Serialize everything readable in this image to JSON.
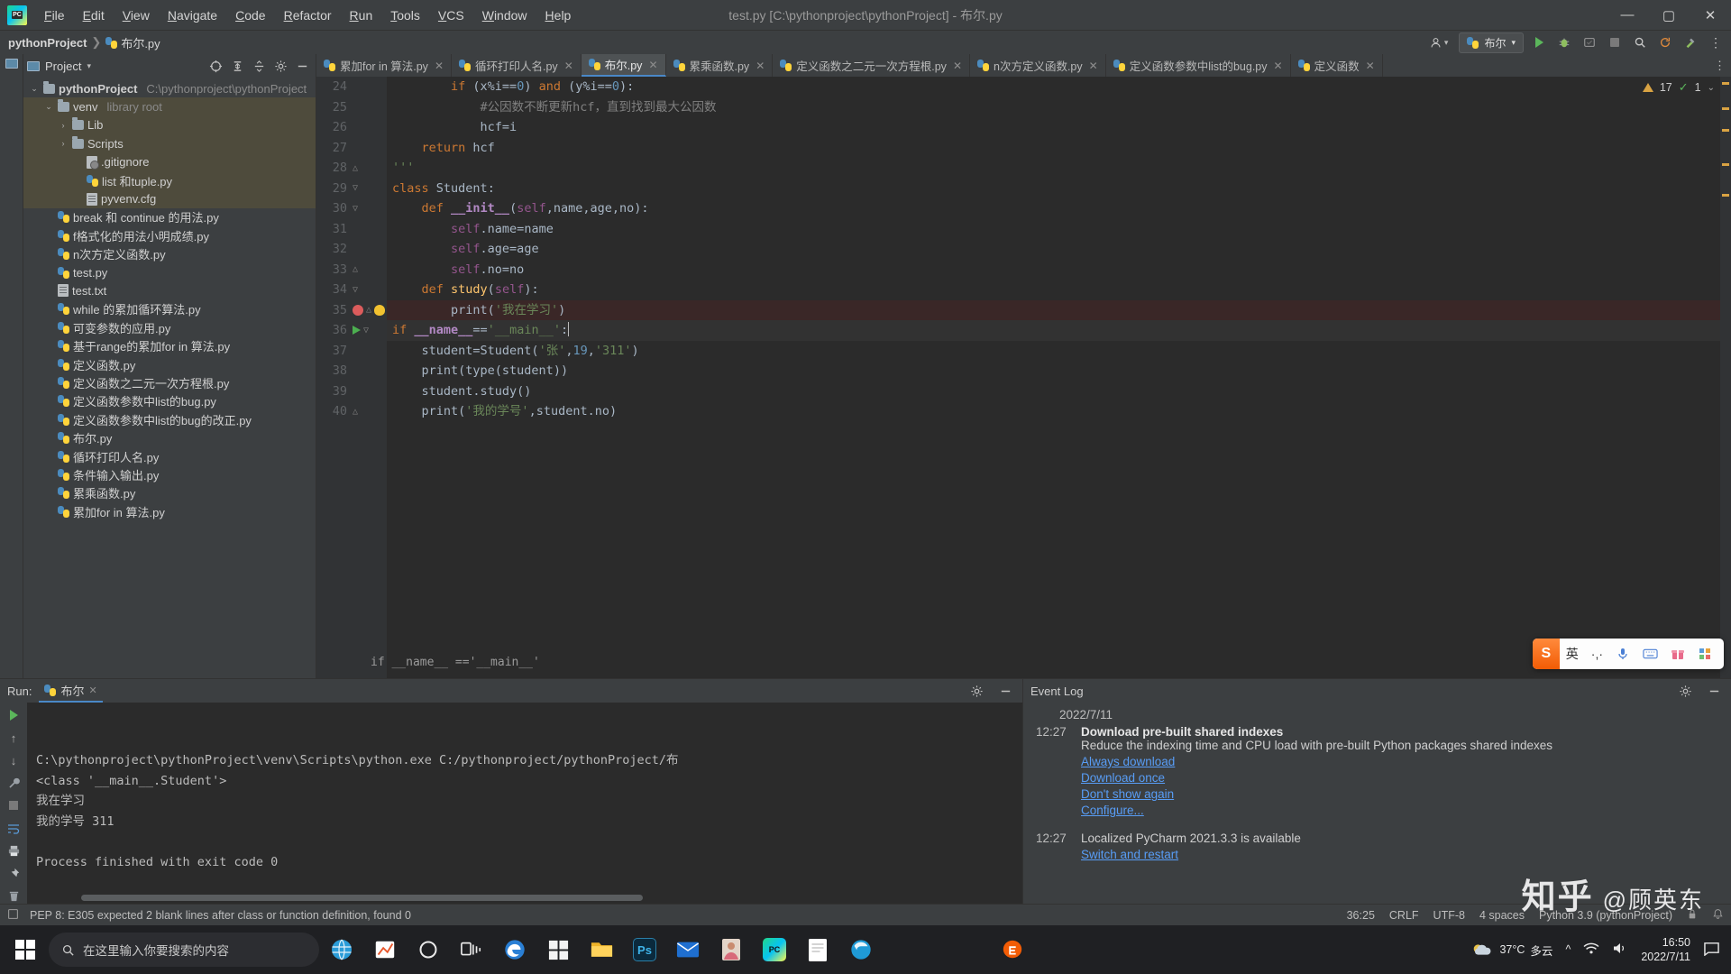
{
  "window": {
    "title": "test.py [C:\\pythonproject\\pythonProject] - 布尔.py",
    "minimize": "—",
    "maximize": "▢",
    "close": "✕",
    "logo_text": "PC"
  },
  "menu": {
    "items": [
      "File",
      "Edit",
      "View",
      "Navigate",
      "Code",
      "Refactor",
      "Run",
      "Tools",
      "VCS",
      "Window",
      "Help"
    ]
  },
  "breadcrumb": {
    "project": "pythonProject",
    "separator": "❯",
    "file": "布尔.py"
  },
  "navbar_right": {
    "account_icon": "user-icon",
    "run_config": "布尔",
    "run_icon": "▶",
    "debug_icon": "🐞",
    "coverage_icon": "▣",
    "stop_icon": "■",
    "search_icon": "🔍",
    "updates_icon": "↻",
    "hammer_icon": "🔨"
  },
  "project_pane": {
    "title": "Project",
    "collapse_icon": "▾",
    "toolbar_icons": [
      "target-icon",
      "expand-all-icon",
      "collapse-all-icon",
      "settings-icon",
      "hide-icon"
    ],
    "tree": [
      {
        "label": "pythonProject",
        "suffix": "C:\\pythonproject\\pythonProject",
        "indent": 0,
        "arrow": "⌄",
        "icon": "folder",
        "bold": true,
        "selected": false
      },
      {
        "label": "venv",
        "suffix": "library root",
        "indent": 1,
        "arrow": "⌄",
        "icon": "folder",
        "bold": false,
        "selected": true
      },
      {
        "label": "Lib",
        "suffix": "",
        "indent": 2,
        "arrow": "›",
        "icon": "folder",
        "bold": false,
        "selected": true
      },
      {
        "label": "Scripts",
        "suffix": "",
        "indent": 2,
        "arrow": "›",
        "icon": "folder",
        "bold": false,
        "selected": true
      },
      {
        "label": ".gitignore",
        "suffix": "",
        "indent": 3,
        "arrow": "",
        "icon": "git",
        "bold": false,
        "selected": true
      },
      {
        "label": "list 和tuple.py",
        "suffix": "",
        "indent": 3,
        "arrow": "",
        "icon": "python",
        "bold": false,
        "selected": true
      },
      {
        "label": "pyvenv.cfg",
        "suffix": "",
        "indent": 3,
        "arrow": "",
        "icon": "file",
        "bold": false,
        "selected": true
      },
      {
        "label": "break 和 continue 的用法.py",
        "suffix": "",
        "indent": 1,
        "arrow": "",
        "icon": "python",
        "bold": false,
        "selected": false
      },
      {
        "label": "f格式化的用法小明成绩.py",
        "suffix": "",
        "indent": 1,
        "arrow": "",
        "icon": "python",
        "bold": false,
        "selected": false
      },
      {
        "label": "n次方定义函数.py",
        "suffix": "",
        "indent": 1,
        "arrow": "",
        "icon": "python",
        "bold": false,
        "selected": false
      },
      {
        "label": "test.py",
        "suffix": "",
        "indent": 1,
        "arrow": "",
        "icon": "python",
        "bold": false,
        "selected": false
      },
      {
        "label": "test.txt",
        "suffix": "",
        "indent": 1,
        "arrow": "",
        "icon": "file",
        "bold": false,
        "selected": false
      },
      {
        "label": "while 的累加循环算法.py",
        "suffix": "",
        "indent": 1,
        "arrow": "",
        "icon": "python",
        "bold": false,
        "selected": false
      },
      {
        "label": "可变参数的应用.py",
        "suffix": "",
        "indent": 1,
        "arrow": "",
        "icon": "python",
        "bold": false,
        "selected": false
      },
      {
        "label": "基于range的累加for in 算法.py",
        "suffix": "",
        "indent": 1,
        "arrow": "",
        "icon": "python",
        "bold": false,
        "selected": false
      },
      {
        "label": "定义函数.py",
        "suffix": "",
        "indent": 1,
        "arrow": "",
        "icon": "python",
        "bold": false,
        "selected": false
      },
      {
        "label": "定义函数之二元一次方程根.py",
        "suffix": "",
        "indent": 1,
        "arrow": "",
        "icon": "python",
        "bold": false,
        "selected": false
      },
      {
        "label": "定义函数参数中list的bug.py",
        "suffix": "",
        "indent": 1,
        "arrow": "",
        "icon": "python",
        "bold": false,
        "selected": false
      },
      {
        "label": "定义函数参数中list的bug的改正.py",
        "suffix": "",
        "indent": 1,
        "arrow": "",
        "icon": "python",
        "bold": false,
        "selected": false
      },
      {
        "label": "布尔.py",
        "suffix": "",
        "indent": 1,
        "arrow": "",
        "icon": "python",
        "bold": false,
        "selected": false
      },
      {
        "label": "循环打印人名.py",
        "suffix": "",
        "indent": 1,
        "arrow": "",
        "icon": "python",
        "bold": false,
        "selected": false
      },
      {
        "label": "条件输入输出.py",
        "suffix": "",
        "indent": 1,
        "arrow": "",
        "icon": "python",
        "bold": false,
        "selected": false
      },
      {
        "label": "累乘函数.py",
        "suffix": "",
        "indent": 1,
        "arrow": "",
        "icon": "python",
        "bold": false,
        "selected": false
      },
      {
        "label": "累加for in 算法.py",
        "suffix": "",
        "indent": 1,
        "arrow": "",
        "icon": "python",
        "bold": false,
        "selected": false
      }
    ]
  },
  "editor_tabs": [
    {
      "label": "累加for in 算法.py",
      "active": false
    },
    {
      "label": "循环打印人名.py",
      "active": false
    },
    {
      "label": "布尔.py",
      "active": true
    },
    {
      "label": "累乘函数.py",
      "active": false
    },
    {
      "label": "定义函数之二元一次方程根.py",
      "active": false
    },
    {
      "label": "n次方定义函数.py",
      "active": false
    },
    {
      "label": "定义函数参数中list的bug.py",
      "active": false
    },
    {
      "label": "定义函数",
      "active": false
    }
  ],
  "editor": {
    "inspection_warnings": "17",
    "inspection_ok": "1",
    "chevron": "⌄",
    "inlay_hint": "if __name__ =='__main__'",
    "lines": [
      {
        "num": "24",
        "indent": 8,
        "tokens": [
          {
            "t": "if ",
            "c": "k"
          },
          {
            "t": "(x%i==",
            "c": "df"
          },
          {
            "t": "0",
            "c": "num"
          },
          {
            "t": ") ",
            "c": "df"
          },
          {
            "t": "and",
            "c": "k"
          },
          {
            "t": " (y%i==",
            "c": "df"
          },
          {
            "t": "0",
            "c": "num"
          },
          {
            "t": "):",
            "c": "df"
          }
        ],
        "gutter": []
      },
      {
        "num": "25",
        "indent": 12,
        "tokens": [
          {
            "t": "#公因数不断更新hcf，直到找到最大公因数",
            "c": "cm"
          }
        ],
        "gutter": []
      },
      {
        "num": "26",
        "indent": 12,
        "tokens": [
          {
            "t": "hcf=i",
            "c": "df"
          }
        ],
        "gutter": []
      },
      {
        "num": "27",
        "indent": 4,
        "tokens": [
          {
            "t": "return",
            "c": "k"
          },
          {
            "t": " hcf",
            "c": "df"
          }
        ],
        "gutter": []
      },
      {
        "num": "28",
        "indent": 0,
        "tokens": [
          {
            "t": "'''",
            "c": "s"
          }
        ],
        "gutter": [
          "fold-end"
        ]
      },
      {
        "num": "29",
        "indent": 0,
        "tokens": [
          {
            "t": "class ",
            "c": "k"
          },
          {
            "t": "Student",
            "c": "df"
          },
          {
            "t": ":",
            "c": "df"
          }
        ],
        "gutter": [
          "fold"
        ]
      },
      {
        "num": "30",
        "indent": 4,
        "tokens": [
          {
            "t": "def ",
            "c": "k"
          },
          {
            "t": "__init__",
            "c": "dunder"
          },
          {
            "t": "(",
            "c": "df"
          },
          {
            "t": "self",
            "c": "self"
          },
          {
            "t": ",name,age,no):",
            "c": "df"
          }
        ],
        "gutter": [
          "fold"
        ]
      },
      {
        "num": "31",
        "indent": 8,
        "tokens": [
          {
            "t": "self",
            "c": "self"
          },
          {
            "t": ".name=name",
            "c": "df"
          }
        ],
        "gutter": []
      },
      {
        "num": "32",
        "indent": 8,
        "tokens": [
          {
            "t": "self",
            "c": "self"
          },
          {
            "t": ".age=age",
            "c": "df"
          }
        ],
        "gutter": []
      },
      {
        "num": "33",
        "indent": 8,
        "tokens": [
          {
            "t": "self",
            "c": "self"
          },
          {
            "t": ".no=no",
            "c": "df"
          }
        ],
        "gutter": [
          "fold-end"
        ]
      },
      {
        "num": "34",
        "indent": 4,
        "tokens": [
          {
            "t": "def ",
            "c": "k"
          },
          {
            "t": "study",
            "c": "fn"
          },
          {
            "t": "(",
            "c": "df"
          },
          {
            "t": "self",
            "c": "self"
          },
          {
            "t": "):",
            "c": "df"
          }
        ],
        "gutter": [
          "fold"
        ]
      },
      {
        "num": "35",
        "indent": 8,
        "tokens": [
          {
            "t": "print",
            "c": "df"
          },
          {
            "t": "(",
            "c": "df"
          },
          {
            "t": "'我在学习'",
            "c": "s"
          },
          {
            "t": ")",
            "c": "df"
          }
        ],
        "gutter": [
          "breakpoint",
          "fold-end",
          "bulb"
        ],
        "highlight": true
      },
      {
        "num": "36",
        "indent": 0,
        "tokens": [
          {
            "t": "if ",
            "c": "k"
          },
          {
            "t": "__name__",
            "c": "dunder"
          },
          {
            "t": "==",
            "c": "df"
          },
          {
            "t": "'__main__'",
            "c": "s"
          },
          {
            "t": ":",
            "c": "df"
          }
        ],
        "gutter": [
          "run",
          "fold"
        ],
        "cursor": true
      },
      {
        "num": "37",
        "indent": 4,
        "tokens": [
          {
            "t": "student=Student(",
            "c": "df"
          },
          {
            "t": "'张'",
            "c": "s"
          },
          {
            "t": ",",
            "c": "df"
          },
          {
            "t": "19",
            "c": "num"
          },
          {
            "t": ",",
            "c": "df"
          },
          {
            "t": "'311'",
            "c": "s"
          },
          {
            "t": ")",
            "c": "df"
          }
        ],
        "gutter": []
      },
      {
        "num": "38",
        "indent": 4,
        "tokens": [
          {
            "t": "print(type(student))",
            "c": "df"
          }
        ],
        "gutter": []
      },
      {
        "num": "39",
        "indent": 4,
        "tokens": [
          {
            "t": "student.study()",
            "c": "df"
          }
        ],
        "gutter": []
      },
      {
        "num": "40",
        "indent": 4,
        "tokens": [
          {
            "t": "print(",
            "c": "df"
          },
          {
            "t": "'我的学号'",
            "c": "s"
          },
          {
            "t": ",student.no)",
            "c": "df"
          }
        ],
        "gutter": [
          "fold-end"
        ]
      }
    ]
  },
  "ime": {
    "logo": "S",
    "items": [
      "英",
      "·,·",
      "mic-icon",
      "keyboard-icon",
      "gift-icon",
      "apps-icon"
    ]
  },
  "run_panel": {
    "label": "Run:",
    "tab": "布尔",
    "close": "✕",
    "settings_icon": "⚙",
    "hide_icon": "—",
    "strip_icons": [
      "run-icon",
      "up-icon",
      "down-icon",
      "wrench-icon",
      "stop-icon",
      "soft-wrap-icon",
      "print-icon",
      "pin-icon",
      "trash-icon"
    ],
    "output": [
      "C:\\pythonproject\\pythonProject\\venv\\Scripts\\python.exe C:/pythonproject/pythonProject/布",
      "<class '__main__.Student'>",
      "我在学习",
      "我的学号 311",
      "",
      "Process finished with exit code 0"
    ]
  },
  "event_log": {
    "title": "Event Log",
    "settings_icon": "⚙",
    "hide_icon": "—",
    "date": "2022/7/11",
    "entries": [
      {
        "time": "12:27",
        "title": "Download pre-built shared indexes",
        "desc": "Reduce the indexing time and CPU load with pre-built Python packages shared indexes",
        "links": [
          "Always download",
          "Download once",
          "Don't show again",
          "Configure..."
        ]
      },
      {
        "time": "12:27",
        "title": "",
        "desc": "Localized PyCharm 2021.3.3 is available",
        "links": [
          "Switch and restart"
        ]
      }
    ]
  },
  "status_bar": {
    "message": "PEP 8: E305 expected 2 blank lines after class or function definition, found 0",
    "caret": "36:25",
    "line_sep": "CRLF",
    "encoding": "UTF-8",
    "indent": "4 spaces",
    "interpreter": "Python 3.9 (pythonProject)",
    "lock_icon": "🔒"
  },
  "taskbar": {
    "search_placeholder": "在这里输入你要搜索的内容",
    "search_icon": "🔍",
    "icons": [
      "edge-browser",
      "cortana-circle",
      "task-view",
      "edge",
      "store",
      "explorer",
      "photoshop",
      "mail",
      "person-app",
      "pycharm",
      "document",
      "chrome-like"
    ],
    "weather": {
      "temp": "37°C",
      "desc": "多云"
    },
    "clock": {
      "time": "16:50",
      "date": "2022/7/11"
    },
    "tray": [
      "^",
      "wifi-icon",
      "volume-icon"
    ],
    "notification_icon": "▭"
  },
  "watermark": {
    "main": "知乎",
    "sub": "@顾英东"
  }
}
